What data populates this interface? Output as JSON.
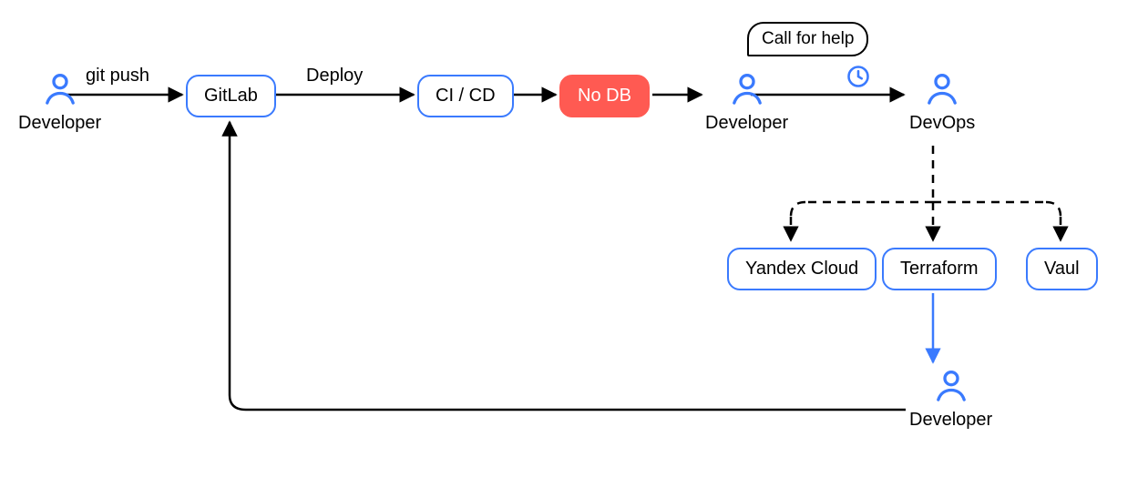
{
  "actors": {
    "dev1": "Developer",
    "dev2": "Developer",
    "devops": "DevOps",
    "dev3": "Developer"
  },
  "nodes": {
    "gitlab": "GitLab",
    "cicd": "CI / CD",
    "nodb": "No DB",
    "yandex": "Yandex Cloud",
    "terraform": "Terraform",
    "vault": "Vaul"
  },
  "edges": {
    "push": "git push",
    "deploy": "Deploy",
    "help": "Call for help"
  },
  "colors": {
    "accent": "#3a7afe",
    "danger": "#ff5a52",
    "ink": "#000000"
  }
}
